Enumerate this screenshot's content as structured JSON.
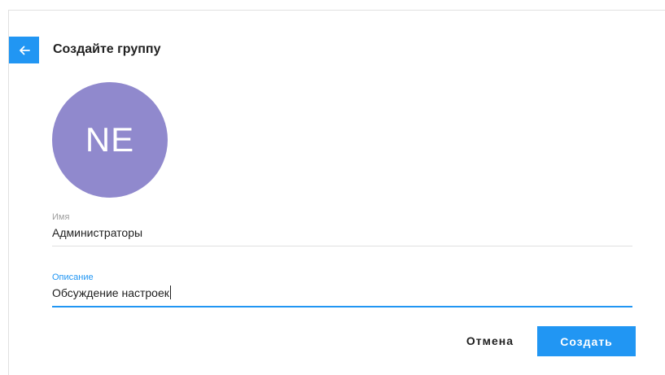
{
  "dialog": {
    "title": "Создайте группу",
    "back_icon": "arrow-left-icon"
  },
  "avatar": {
    "initials": "NE",
    "color": "#9089cd"
  },
  "form": {
    "name": {
      "label": "Имя",
      "value": "Администраторы"
    },
    "description": {
      "label": "Описание",
      "value": "Обсуждение настроек"
    }
  },
  "actions": {
    "cancel_label": "Отмена",
    "create_label": "Создать"
  },
  "colors": {
    "accent": "#2196f3",
    "text": "#212121",
    "muted": "#9e9e9e",
    "divider": "#e0e0e0"
  }
}
